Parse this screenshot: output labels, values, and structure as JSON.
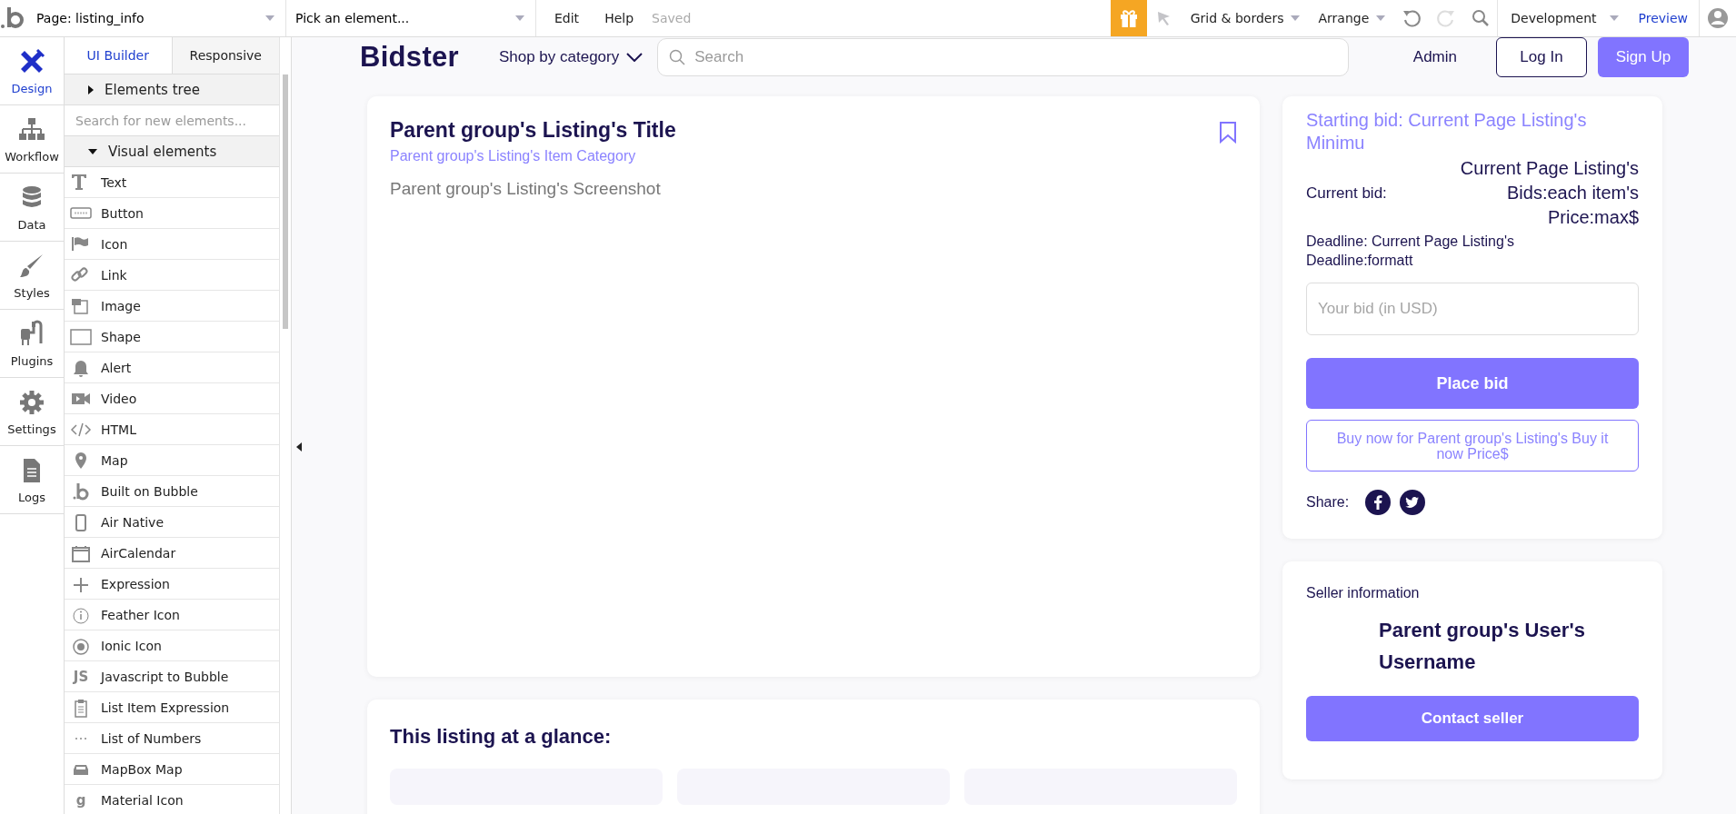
{
  "toolbar": {
    "page_select": "Page: listing_info",
    "element_select": "Pick an element...",
    "menu": [
      {
        "label": "Edit"
      },
      {
        "label": "Help"
      }
    ],
    "save_status": "Saved",
    "grid_menu": "Grid & borders",
    "arrange_menu": "Arrange",
    "undo_disabled": false,
    "redo_disabled": true,
    "environment": "Development",
    "preview": "Preview"
  },
  "nav": [
    {
      "label": "Design",
      "selected": true
    },
    {
      "label": "Workflow",
      "selected": false
    },
    {
      "label": "Data",
      "selected": false
    },
    {
      "label": "Styles",
      "selected": false
    },
    {
      "label": "Plugins",
      "selected": false
    },
    {
      "label": "Settings",
      "selected": false
    },
    {
      "label": "Logs",
      "selected": false
    }
  ],
  "panel": {
    "tabs": [
      {
        "label": "UI Builder",
        "selected": true
      },
      {
        "label": "Responsive",
        "selected": false
      }
    ],
    "elements_tree": {
      "label": "Elements tree",
      "expanded": false
    },
    "search": {
      "placeholder": "Search for new elements..."
    },
    "visual_elements": {
      "label": "Visual elements",
      "expanded": true,
      "items": [
        {
          "label": "Text"
        },
        {
          "label": "Button"
        },
        {
          "label": "Icon"
        },
        {
          "label": "Link"
        },
        {
          "label": "Image"
        },
        {
          "label": "Shape"
        },
        {
          "label": "Alert"
        },
        {
          "label": "Video"
        },
        {
          "label": "HTML"
        },
        {
          "label": "Map"
        },
        {
          "label": "Built on Bubble"
        },
        {
          "label": "Air Native"
        },
        {
          "label": "AirCalendar"
        },
        {
          "label": "Expression"
        },
        {
          "label": "Feather Icon"
        },
        {
          "label": "Ionic Icon"
        },
        {
          "label": "Javascript to Bubble",
          "glyph": "JS"
        },
        {
          "label": "List Item Expression"
        },
        {
          "label": "List of Numbers"
        },
        {
          "label": "MapBox Map"
        },
        {
          "label": "Material Icon",
          "glyph": "g"
        }
      ]
    }
  },
  "canvas": {
    "header": {
      "logo": "Bidster",
      "category_menu": "Shop by category",
      "search": {
        "placeholder": "Search"
      },
      "admin_link": "Admin",
      "login_button": "Log In",
      "signup_button": "Sign Up"
    },
    "listing": {
      "title": "Parent group's Listing's Title",
      "category": "Parent group's Listing's Item Category",
      "screenshot": "Parent group's Listing's Screenshot"
    },
    "bid_card": {
      "starting_bid": "Starting bid: Current Page Listing's Minimu",
      "current_bid_label": "Current bid:",
      "current_bid_value": "Current Page Listing's Bids:each item's Price:max$",
      "deadline": "Deadline: Current Page Listing's Deadline:formatt",
      "bid_input": {
        "placeholder": "Your bid (in USD)"
      },
      "place_bid_button": "Place bid",
      "buy_now_button": "Buy now for Parent group's Listing's Buy it now Price$",
      "share_label": "Share:"
    },
    "seller_card": {
      "heading": "Seller information",
      "username": "Parent group's User's Username",
      "contact_button": "Contact seller"
    },
    "glance_card": {
      "heading": "This listing at a glance:"
    }
  }
}
